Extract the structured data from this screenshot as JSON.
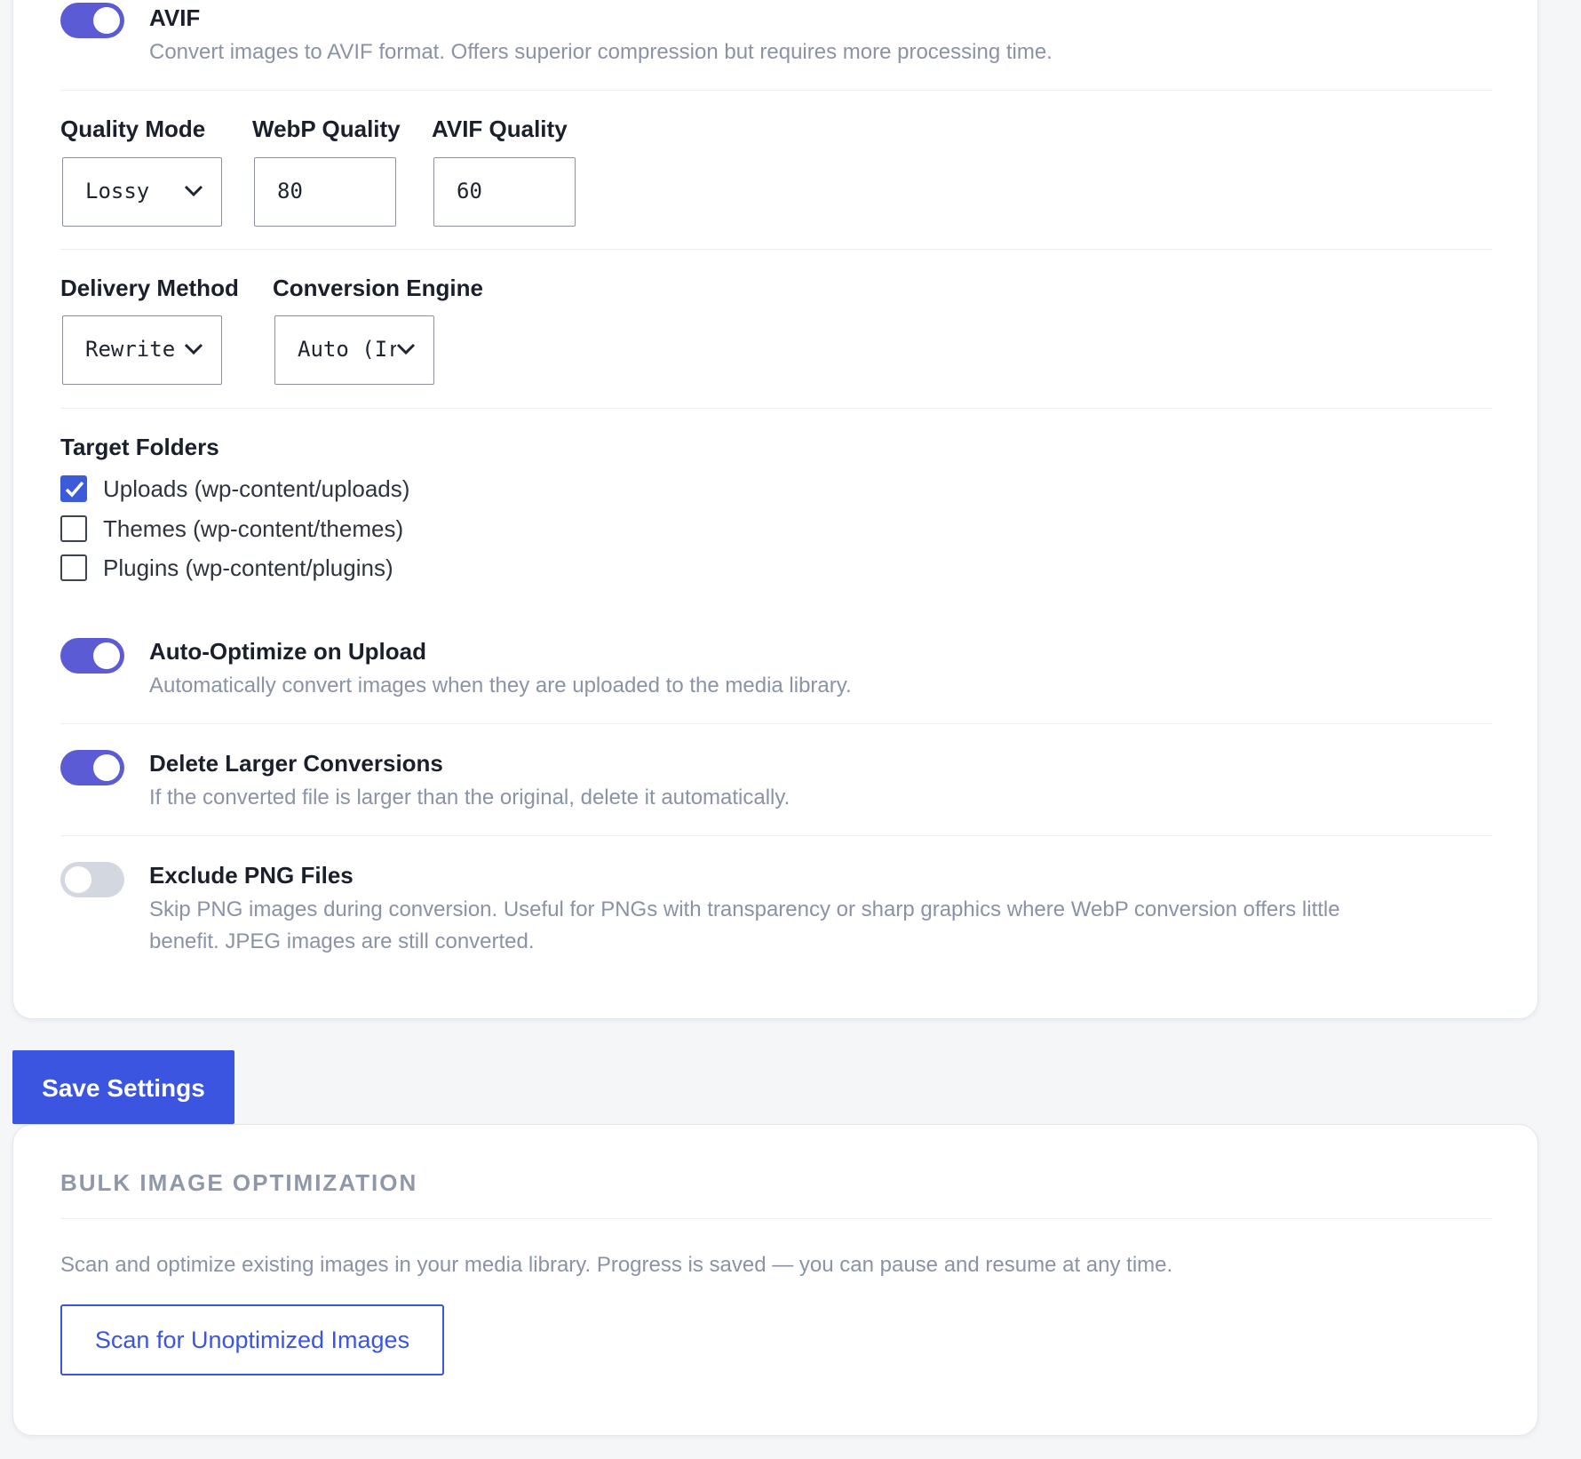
{
  "formats": {
    "avif": {
      "title": "AVIF",
      "description": "Convert images to AVIF format. Offers superior compression but requires more processing time.",
      "enabled": true
    }
  },
  "quality": {
    "mode_label": "Quality Mode",
    "mode_value": "Lossy",
    "webp_label": "WebP Quality",
    "webp_value": "80",
    "avif_label": "AVIF Quality",
    "avif_value": "60"
  },
  "delivery": {
    "method_label": "Delivery Method",
    "method_value": "Rewrite",
    "engine_label": "Conversion Engine",
    "engine_value": "Auto (Ir"
  },
  "target_folders": {
    "label": "Target Folders",
    "items": [
      {
        "label": "Uploads (wp-content/uploads)",
        "checked": true
      },
      {
        "label": "Themes (wp-content/themes)",
        "checked": false
      },
      {
        "label": "Plugins (wp-content/plugins)",
        "checked": false
      }
    ]
  },
  "options": [
    {
      "title": "Auto-Optimize on Upload",
      "description": "Automatically convert images when they are uploaded to the media library.",
      "enabled": true
    },
    {
      "title": "Delete Larger Conversions",
      "description": "If the converted file is larger than the original, delete it automatically.",
      "enabled": true
    },
    {
      "title": "Exclude PNG Files",
      "description_line1": "Skip PNG images during conversion. Useful for PNGs with transparency or sharp graphics where WebP conversion offers little",
      "description_line2": "benefit. JPEG images are still converted.",
      "enabled": false
    }
  ],
  "save_button": "Save Settings",
  "bulk": {
    "title": "BULK IMAGE OPTIMIZATION",
    "description": "Scan and optimize existing images in your media library. Progress is saved — you can pause and resume at any time.",
    "scan_button": "Scan for Unoptimized Images"
  },
  "colors": {
    "accent": "#3b55e0",
    "toggle_on": "#5b5bd6",
    "toggle_off": "#d3d8e0",
    "muted_text": "#8a93a6"
  }
}
